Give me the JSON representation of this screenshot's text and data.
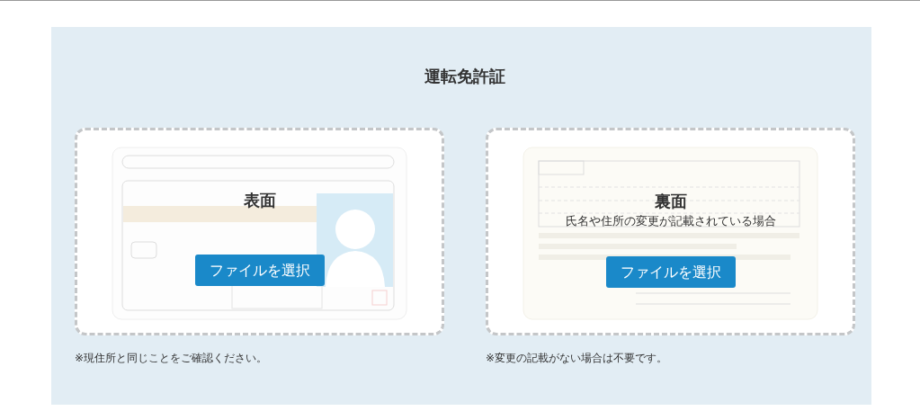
{
  "title": "運転免許証",
  "uploads": [
    {
      "kind": "front",
      "label": "表面",
      "button": "ファイルを選択",
      "note": "※現住所と同じことをご確認ください。"
    },
    {
      "kind": "back",
      "label": "裏面",
      "sublabel": "氏名や住所の変更が記載されている場合",
      "button": "ファイルを選択",
      "note": "※変更の記載がない場合は不要です。"
    }
  ]
}
